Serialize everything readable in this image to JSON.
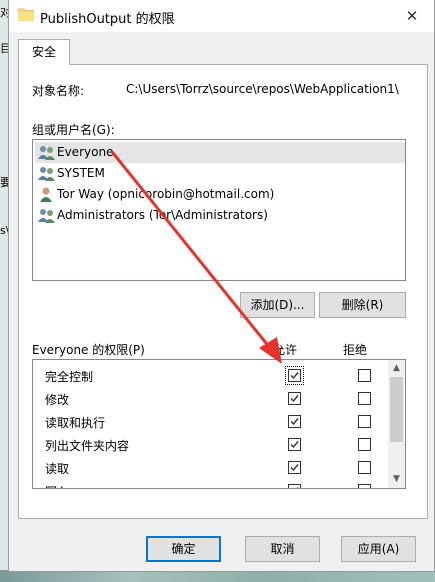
{
  "window": {
    "title": "PublishOutput 的权限",
    "close_glyph": "✕"
  },
  "tabs": [
    {
      "label": "安全"
    }
  ],
  "object": {
    "label": "对象名称:",
    "value": "C:\\Users\\Torrz\\source\\repos\\WebApplication1\\"
  },
  "groups": {
    "label": "组或用户名(G):",
    "items": [
      {
        "name": "Everyone",
        "icon": "users-group-icon",
        "selected": true
      },
      {
        "name": "SYSTEM",
        "icon": "users-group-icon",
        "selected": false
      },
      {
        "name": "Tor Way (opnicorobin@hotmail.com)",
        "icon": "user-icon",
        "selected": false
      },
      {
        "name": "Administrators (Tor\\Administrators)",
        "icon": "users-group-icon",
        "selected": false
      }
    ],
    "add_label": "添加(D)...",
    "remove_label": "删除(R)"
  },
  "permissions": {
    "label": "Everyone 的权限(P)",
    "allow_header": "允许",
    "deny_header": "拒绝",
    "rows": [
      {
        "name": "完全控制",
        "allow": true,
        "deny": false
      },
      {
        "name": "修改",
        "allow": true,
        "deny": false
      },
      {
        "name": "读取和执行",
        "allow": true,
        "deny": false
      },
      {
        "name": "列出文件夹内容",
        "allow": true,
        "deny": false
      },
      {
        "name": "读取",
        "allow": true,
        "deny": false
      },
      {
        "name": "写入",
        "allow": true,
        "deny": false
      }
    ]
  },
  "footer": {
    "ok_label": "确定",
    "cancel_label": "取消",
    "apply_label": "应用(A)"
  },
  "background_fragments": [
    "对",
    "目",
    "要",
    "s\\"
  ],
  "colors": {
    "annotation_arrow": "#e8322b",
    "selection": "#e5e5e5",
    "focus_border": "#0078d7"
  }
}
